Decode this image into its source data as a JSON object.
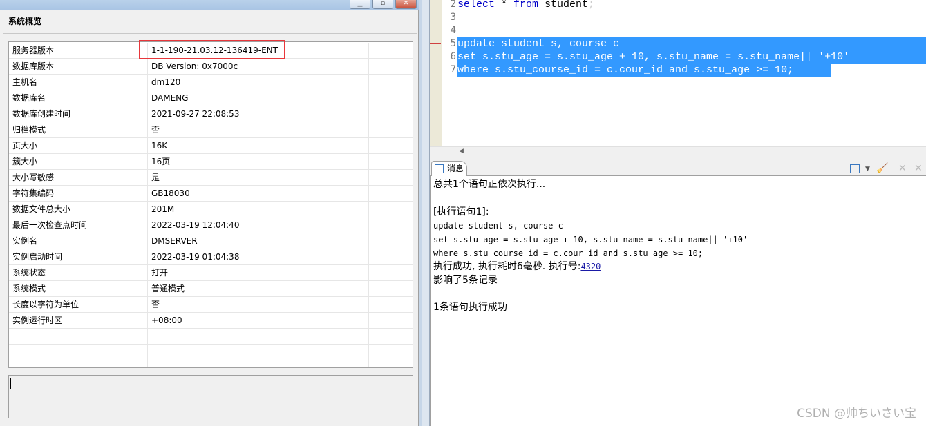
{
  "left_panel": {
    "title": "系统概览",
    "rows": [
      {
        "label": "服务器版本",
        "value": "1-1-190-21.03.12-136419-ENT"
      },
      {
        "label": "数据库版本",
        "value": "DB Version: 0x7000c"
      },
      {
        "label": "主机名",
        "value": "dm120"
      },
      {
        "label": "数据库名",
        "value": "DAMENG"
      },
      {
        "label": "数据库创建时间",
        "value": "2021-09-27 22:08:53"
      },
      {
        "label": "归档模式",
        "value": "否"
      },
      {
        "label": "页大小",
        "value": "16K"
      },
      {
        "label": "簇大小",
        "value": "16页"
      },
      {
        "label": "大小写敏感",
        "value": "是"
      },
      {
        "label": "字符集编码",
        "value": "GB18030"
      },
      {
        "label": "数据文件总大小",
        "value": "201M"
      },
      {
        "label": "最后一次检查点时间",
        "value": "2022-03-19 12:04:40"
      },
      {
        "label": "实例名",
        "value": "DMSERVER"
      },
      {
        "label": "实例启动时间",
        "value": "2022-03-19 01:04:38"
      },
      {
        "label": "系统状态",
        "value": "打开"
      },
      {
        "label": "系统模式",
        "value": "普通模式"
      },
      {
        "label": "长度以字符为单位",
        "value": "否"
      },
      {
        "label": "实例运行时区",
        "value": "+08:00"
      }
    ],
    "highlight_color": "#e8373b"
  },
  "editor": {
    "line_numbers": [
      "2",
      "3",
      "4",
      "5",
      "6",
      "7"
    ],
    "line2": {
      "kw1": "select",
      "mid": " * ",
      "kw2": "from",
      "rest": " student",
      "semi": ";"
    },
    "line5": "update student s, course c",
    "line6": "set s.stu_age = s.stu_age + 10, s.stu_name = s.stu_name|| '+10'",
    "line7": "where s.stu_course_id = c.cour_id and s.stu_age >= 10;",
    "selection_color": "#3399ff"
  },
  "messages": {
    "tab_label": "消息",
    "lines": [
      "总共1个语句正依次执行...",
      "[执行语句1]:",
      "update student s, course c",
      "set s.stu_age = s.stu_age + 10, s.stu_name = s.stu_name|| '+10'",
      "where s.stu_course_id = c.cour_id and s.stu_age >= 10;",
      "执行成功, 执行耗时6毫秒. 执行号:",
      "影响了5条记录",
      "1条语句执行成功"
    ],
    "exec_id": "4320"
  },
  "watermark": "CSDN @帅ちいさい宝"
}
